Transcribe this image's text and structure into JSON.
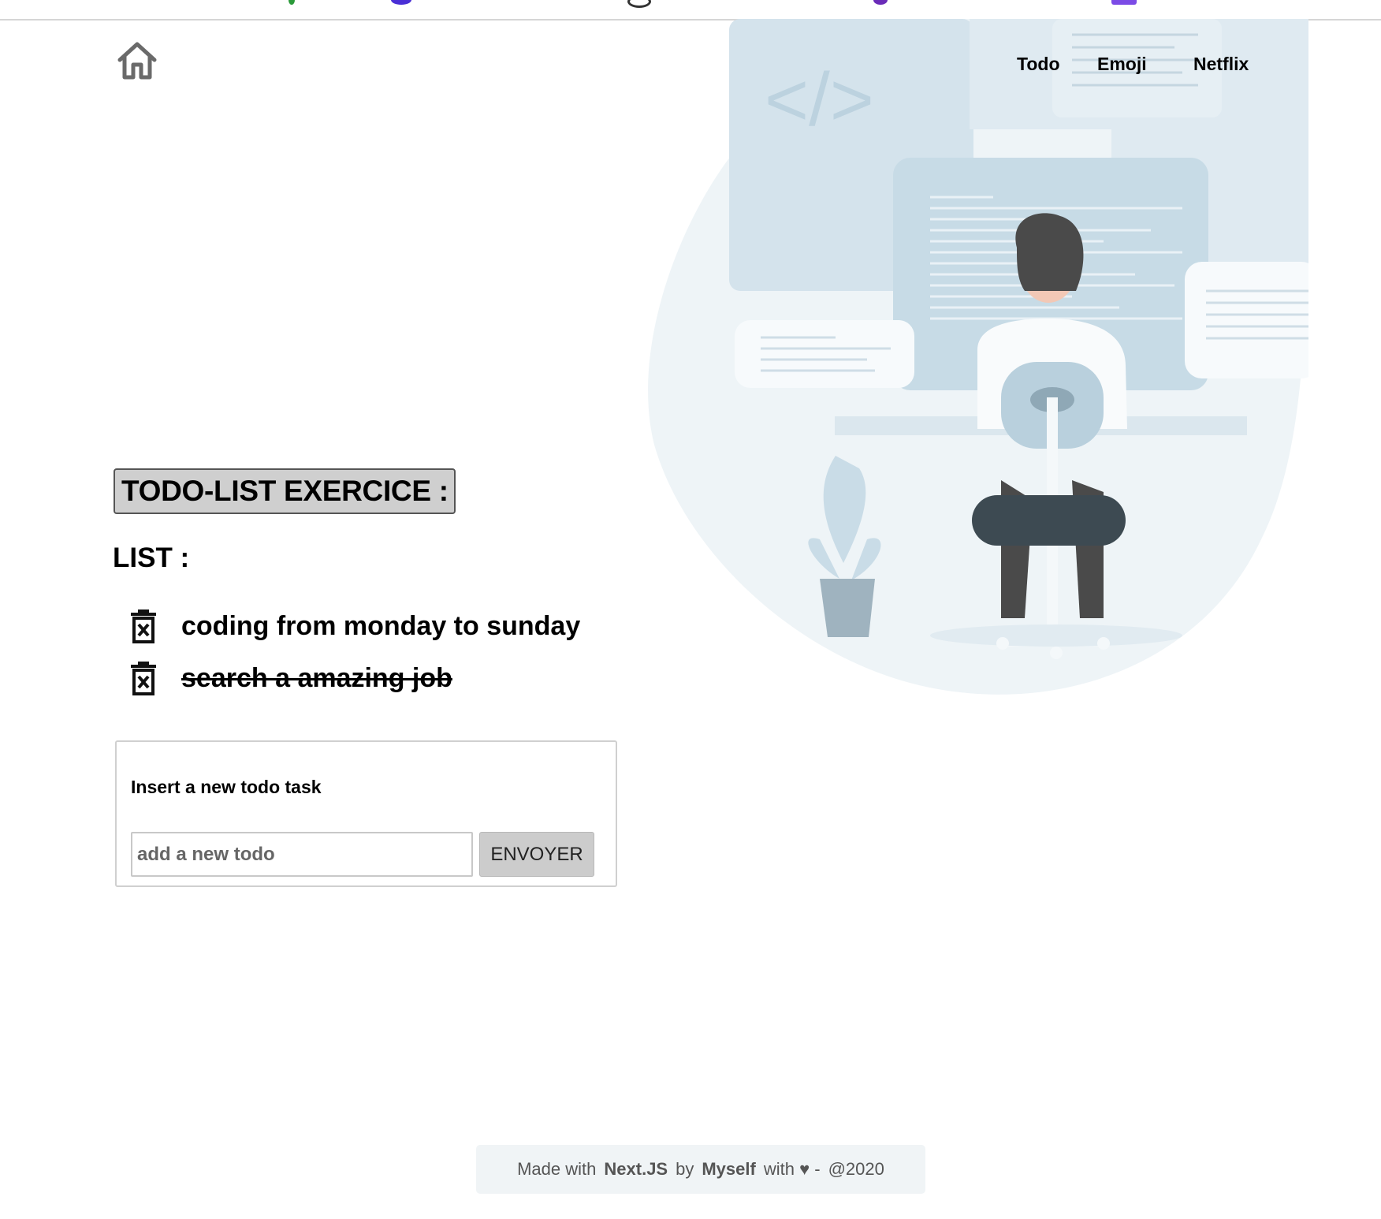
{
  "top_strip": {
    "colors": [
      "#2b9a3a",
      "#4a2fd6",
      "#333333",
      "#6a2bb8",
      "#7b4be6"
    ]
  },
  "header": {
    "home_icon": "home-icon",
    "nav": [
      {
        "label": "Todo"
      },
      {
        "label": "Emoji"
      },
      {
        "label": "Netflix"
      }
    ]
  },
  "hero": {
    "code_symbol": "</>"
  },
  "main": {
    "title": "TODO-LIST EXERCICE :",
    "list_heading": "LIST :",
    "todos": [
      {
        "text": "coding from monday to sunday",
        "done": false,
        "icon": "trash-icon"
      },
      {
        "text": "search a amazing job",
        "done": true,
        "icon": "trash-icon"
      }
    ]
  },
  "form": {
    "label": "Insert a new todo task",
    "input_value": "",
    "placeholder": "add a new todo",
    "submit_label": "ENVOYER"
  },
  "footer": {
    "made_with": "Made with",
    "framework": "Next.JS",
    "by": "by",
    "author": "Myself",
    "with_love": "with ♥ -",
    "year": "@2020"
  },
  "colors": {
    "title_bg": "#cfcfcf",
    "footer_bg": "#f0f4f6",
    "illustration_blue": "#cfe0ea"
  }
}
